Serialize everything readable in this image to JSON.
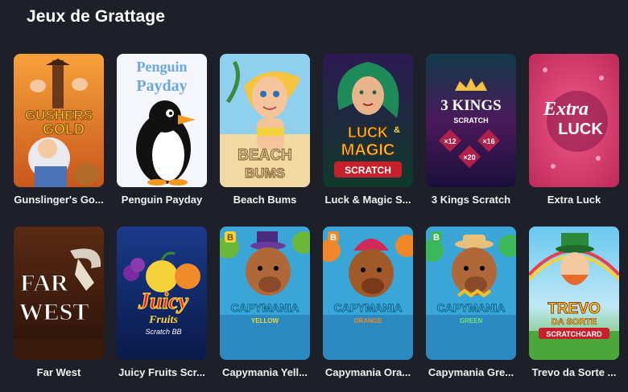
{
  "section": {
    "title": "Jeux de Grattage"
  },
  "games": [
    {
      "label": "Gunslinger's Go...",
      "art_text": [
        "GUSHERS",
        "GOLD"
      ]
    },
    {
      "label": "Penguin Payday",
      "art_text": [
        "Penguin",
        "Payday"
      ]
    },
    {
      "label": "Beach Bums",
      "art_text": [
        "BEACH",
        "BUMS"
      ]
    },
    {
      "label": "Luck & Magic S...",
      "art_text": [
        "LUCK",
        "&",
        "MAGIC",
        "SCRATCH"
      ]
    },
    {
      "label": "3 Kings Scratch",
      "art_text": [
        "3 KINGS",
        "SCRATCH",
        "×12",
        "×16",
        "×20"
      ]
    },
    {
      "label": "Extra Luck",
      "art_text": [
        "Extra",
        "LUCK"
      ]
    },
    {
      "label": "Far West",
      "art_text": [
        "FAR",
        "WEST"
      ]
    },
    {
      "label": "Juicy Fruits Scr...",
      "art_text": [
        "Juicy",
        "Fruits",
        "Scratch BB"
      ]
    },
    {
      "label": "Capymania Yell...",
      "art_text": [
        "B",
        "CAPYMANIA",
        "YELLOW"
      ]
    },
    {
      "label": "Capymania Ora...",
      "art_text": [
        "B",
        "CAPYMANIA",
        "ORANGE"
      ]
    },
    {
      "label": "Capymania Gre...",
      "art_text": [
        "B",
        "CAPYMANIA",
        "GREEN"
      ]
    },
    {
      "label": "Trevo da Sorte ...",
      "art_text": [
        "TREVO",
        "DA SORTE",
        "SCRATCHCARD"
      ]
    }
  ]
}
